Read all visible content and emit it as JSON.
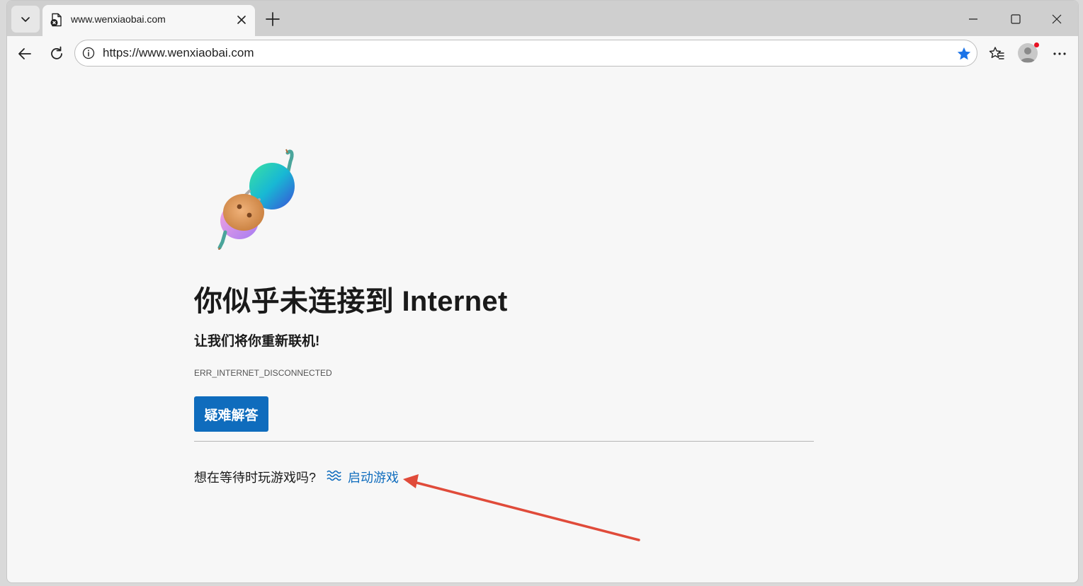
{
  "tab": {
    "title": "www.wenxiaobai.com"
  },
  "address": {
    "url": "https://www.wenxiaobai.com"
  },
  "page": {
    "title": "你似乎未连接到 Internet",
    "subtitle": "让我们将你重新联机!",
    "error_code": "ERR_INTERNET_DISCONNECTED",
    "troubleshoot_label": "疑难解答",
    "game_prompt": "想在等待时玩游戏吗?",
    "game_link": "启动游戏"
  },
  "colors": {
    "accent": "#0f6cbd",
    "favorite_star": "#1a73e8",
    "notification_dot": "#e81123",
    "annotation_arrow": "#e04b3a"
  }
}
